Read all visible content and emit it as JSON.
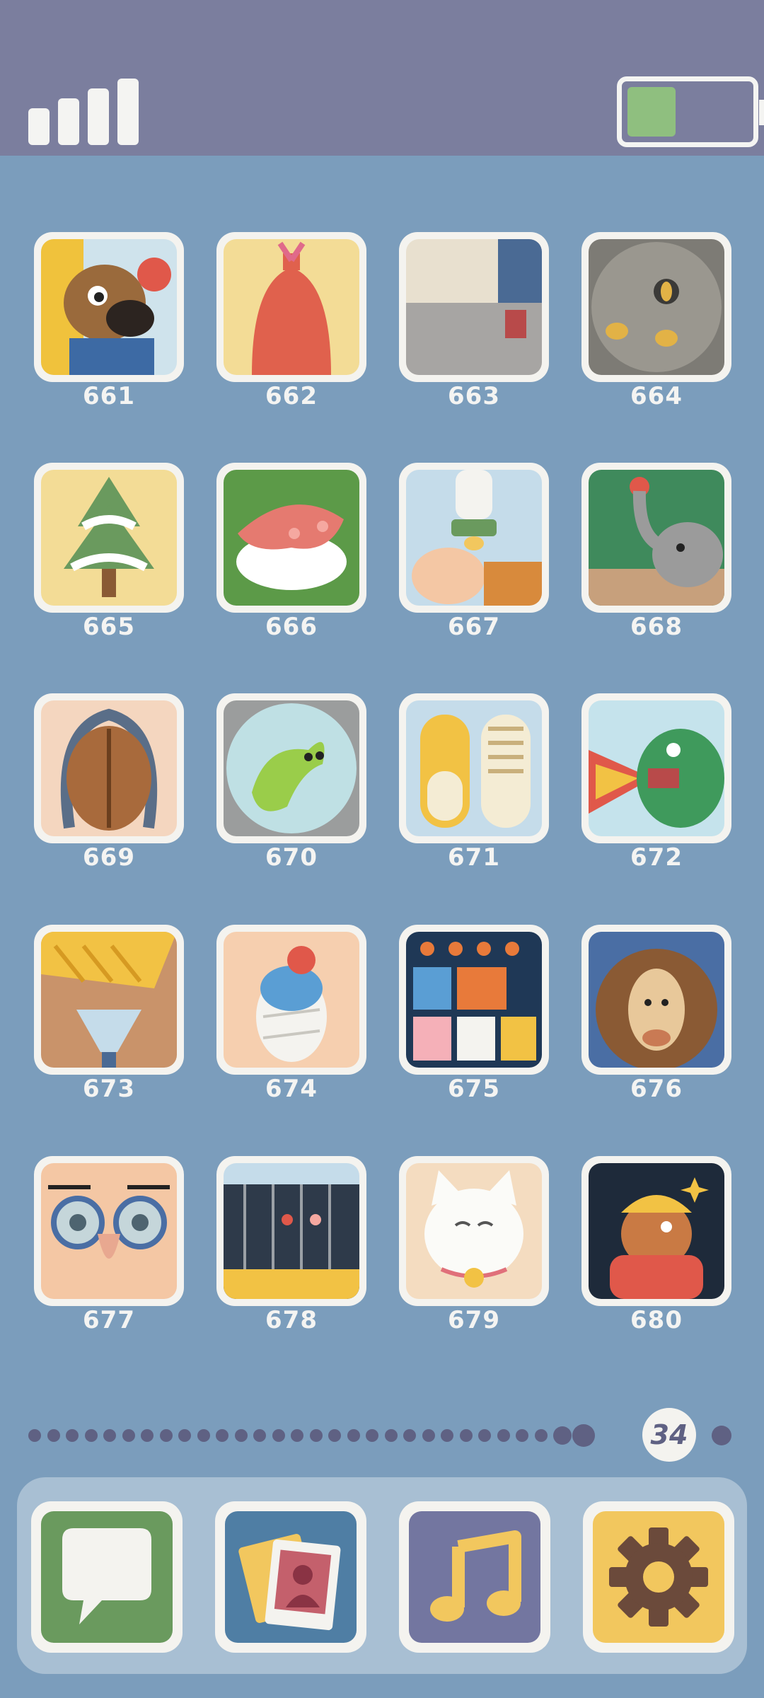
{
  "status_bar": {
    "signal_icon": "signal-bars-icon",
    "battery_icon": "battery-icon",
    "battery_level": 0.4,
    "battery_color": "#8fbf7f"
  },
  "levels": [
    {
      "number": "661",
      "icon": "horse-with-apple"
    },
    {
      "number": "662",
      "icon": "red-wrapped-gift"
    },
    {
      "number": "663",
      "icon": "toaster-bread"
    },
    {
      "number": "664",
      "icon": "coins-in-pan"
    },
    {
      "number": "665",
      "icon": "snowy-tree"
    },
    {
      "number": "666",
      "icon": "octopus-sushi"
    },
    {
      "number": "667",
      "icon": "baby-bottle"
    },
    {
      "number": "668",
      "icon": "elephant-apple"
    },
    {
      "number": "669",
      "icon": "walnut-cracker"
    },
    {
      "number": "670",
      "icon": "germ-petri-dish"
    },
    {
      "number": "671",
      "icon": "yellow-sneakers"
    },
    {
      "number": "672",
      "icon": "fire-dragon"
    },
    {
      "number": "673",
      "icon": "cheese-grater"
    },
    {
      "number": "674",
      "icon": "bandaged-creature"
    },
    {
      "number": "675",
      "icon": "bento-box"
    },
    {
      "number": "676",
      "icon": "lion"
    },
    {
      "number": "677",
      "icon": "glasses-face"
    },
    {
      "number": "678",
      "icon": "butterfly-cages"
    },
    {
      "number": "679",
      "icon": "lucky-cat"
    },
    {
      "number": "680",
      "icon": "hatted-character"
    }
  ],
  "pager": {
    "current_page": "34",
    "dots_before": 30,
    "dots_after": 1
  },
  "dock": [
    {
      "icon": "message-icon",
      "color": "#6a9a5e"
    },
    {
      "icon": "photos-icon",
      "color": "#4f7ea4"
    },
    {
      "icon": "music-icon",
      "color": "#7376a0"
    },
    {
      "icon": "settings-gear-icon",
      "color": "#f2c75e"
    }
  ]
}
